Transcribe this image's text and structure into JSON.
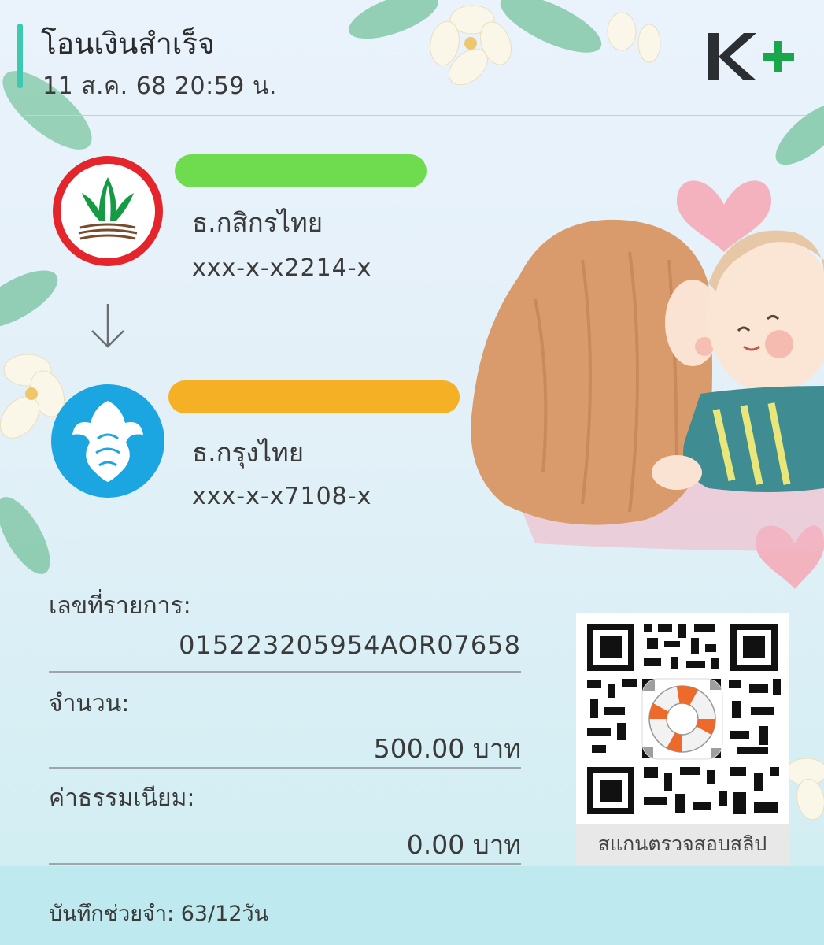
{
  "header": {
    "title": "โอนเงินสำเร็จ",
    "datetime": "11 ส.ค. 68  20:59 น.",
    "brand_logo": "K+",
    "accent_color": "#3dc9b0"
  },
  "sender": {
    "bank_logo_icon": "kasikorn-bank-logo-icon",
    "name_redacted_color": "#6fdc4f",
    "bank": "ธ.กสิกรไทย",
    "account": "xxx-x-x2214-x"
  },
  "transfer_arrow_icon": "arrow-down-icon",
  "receiver": {
    "bank_logo_icon": "krungthai-bank-logo-icon",
    "name_redacted_color": "#f6b026",
    "bank": "ธ.กรุงไทย",
    "account": "xxx-x-x7108-x"
  },
  "details": {
    "ref_label": "เลขที่รายการ:",
    "ref_value": "015223205954AOR07658",
    "amount_label": "จำนวน:",
    "amount_value": "500.00 บาท",
    "fee_label": "ค่าธรรมเนียม:",
    "fee_value": "0.00 บาท"
  },
  "qr": {
    "caption": "สแกนตรวจสอบสลิป",
    "overlay_icon": "lifebuoy-icon"
  },
  "memo": {
    "text": "บันทึกช่วยจำ: 63/12วัน"
  }
}
